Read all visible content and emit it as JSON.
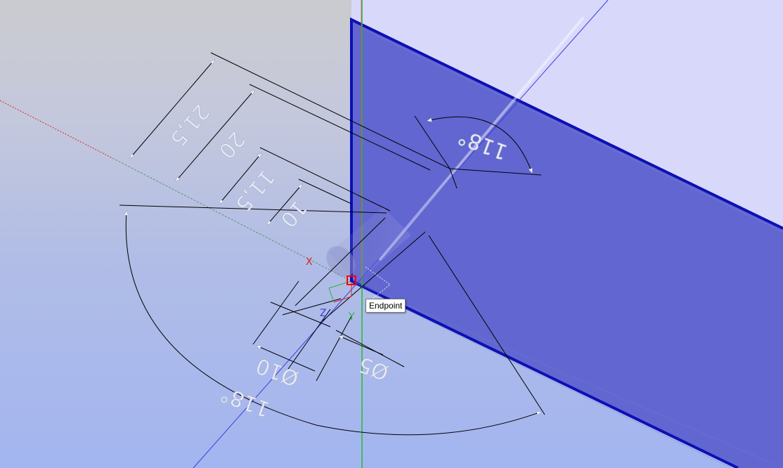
{
  "viewport": {
    "snap_tooltip": "Endpoint",
    "triad_labels": {
      "x": "X",
      "y": "Y",
      "z": "Z"
    },
    "colors": {
      "face_front": "#6266d0",
      "face_top": "#d8d8fb",
      "edge": "#0c10b4",
      "x_axis": "#e0261e",
      "y_axis": "#1fbf2a",
      "z_axis": "#3a3ee0",
      "snap_marker": "#ff0000"
    }
  },
  "dimensions": {
    "linear_21_5": "21,5",
    "linear_20": "20",
    "linear_11_5": "11,5",
    "linear_10": "10",
    "angle_upper": "118°",
    "angle_lower": "118°",
    "diameter_10": "Ø10",
    "diameter_5": "Ø5"
  }
}
